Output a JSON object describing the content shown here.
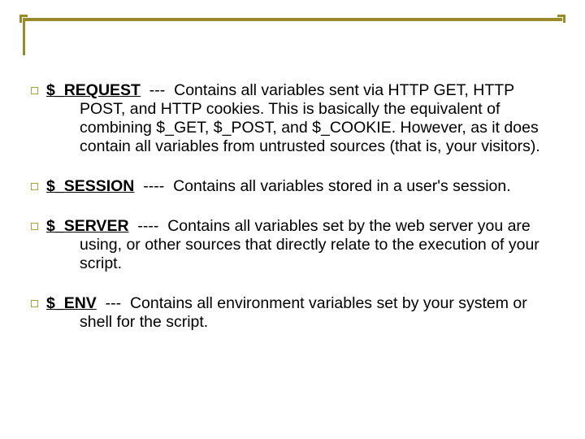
{
  "items": [
    {
      "var": "$_REQUEST",
      "sep": "---",
      "first": "Contains all variables sent via HTTP GET, HTTP",
      "rest": "POST, and HTTP cookies. This is basically the equivalent of combining $_GET, $_POST, and $_COOKIE. However, as it does contain all variables from untrusted sources (that is, your visitors)."
    },
    {
      "var": "$_SESSION",
      "sep": "----",
      "first": "Contains all variables stored in a user's session.",
      "rest": ""
    },
    {
      "var": "$_SERVER",
      "sep": "----",
      "first": "Contains all variables set by the web server you are",
      "rest": "using, or other sources that directly relate to the execution of your script."
    },
    {
      "var": "$_ENV",
      "sep": "---",
      "first": "Contains all environment variables set by your system or",
      "rest": "shell for the script."
    }
  ]
}
